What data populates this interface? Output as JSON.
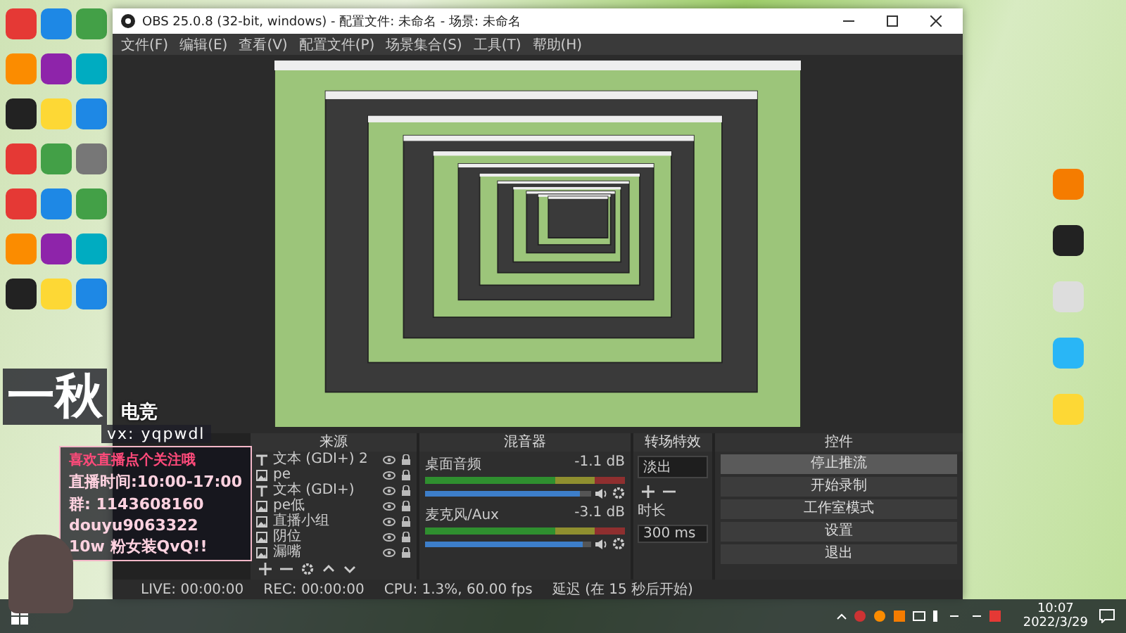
{
  "window": {
    "title": "OBS 25.0.8 (32-bit, windows) - 配置文件: 未命名 - 场景: 未命名"
  },
  "menu": [
    "文件(F)",
    "编辑(E)",
    "查看(V)",
    "配置文件(P)",
    "场景集合(S)",
    "工具(T)",
    "帮助(H)"
  ],
  "sources": {
    "title": "来源",
    "items": [
      {
        "name": "文本 (GDI+) 2",
        "kind": "text"
      },
      {
        "name": "pe",
        "kind": "image"
      },
      {
        "name": "文本 (GDI+)",
        "kind": "text"
      },
      {
        "name": "pe低",
        "kind": "image"
      },
      {
        "name": "直播小组",
        "kind": "image"
      },
      {
        "name": "阴位",
        "kind": "image"
      },
      {
        "name": "漏嘴",
        "kind": "image"
      }
    ]
  },
  "mixer": {
    "title": "混音器",
    "channels": [
      {
        "name": "桌面音频",
        "reading": "-1.1 dB",
        "level": 0.93
      },
      {
        "name": "麦克风/Aux",
        "reading": "-3.1 dB",
        "level": 0.95
      }
    ]
  },
  "transitions": {
    "title": "转场特效",
    "selected": "淡出",
    "duration_label": "时长",
    "duration": "300 ms"
  },
  "controls": {
    "title": "控件",
    "buttons": [
      {
        "label": "停止推流",
        "on": true
      },
      {
        "label": "开始录制",
        "on": false
      },
      {
        "label": "工作室模式",
        "on": false
      },
      {
        "label": "设置",
        "on": false
      },
      {
        "label": "退出",
        "on": false
      }
    ]
  },
  "status_bar": [
    "LIVE: 00:00:00",
    "REC: 00:00:00",
    "CPU: 1.3%, 60.00 fps",
    "延迟 (在 15 秒后开始)"
  ],
  "overlay": {
    "logo": "一秋",
    "tag": "电竞",
    "wechat": "vx: yqpwdl",
    "lines": [
      "喜欢直播点个关注哦",
      "直播时间:10:00-17:00",
      "群: 1143608160",
      "douyu9063322",
      "10w 粉女装QvQ!!"
    ]
  },
  "taskbar": {
    "time": "10:07",
    "date": "2022/3/29"
  }
}
